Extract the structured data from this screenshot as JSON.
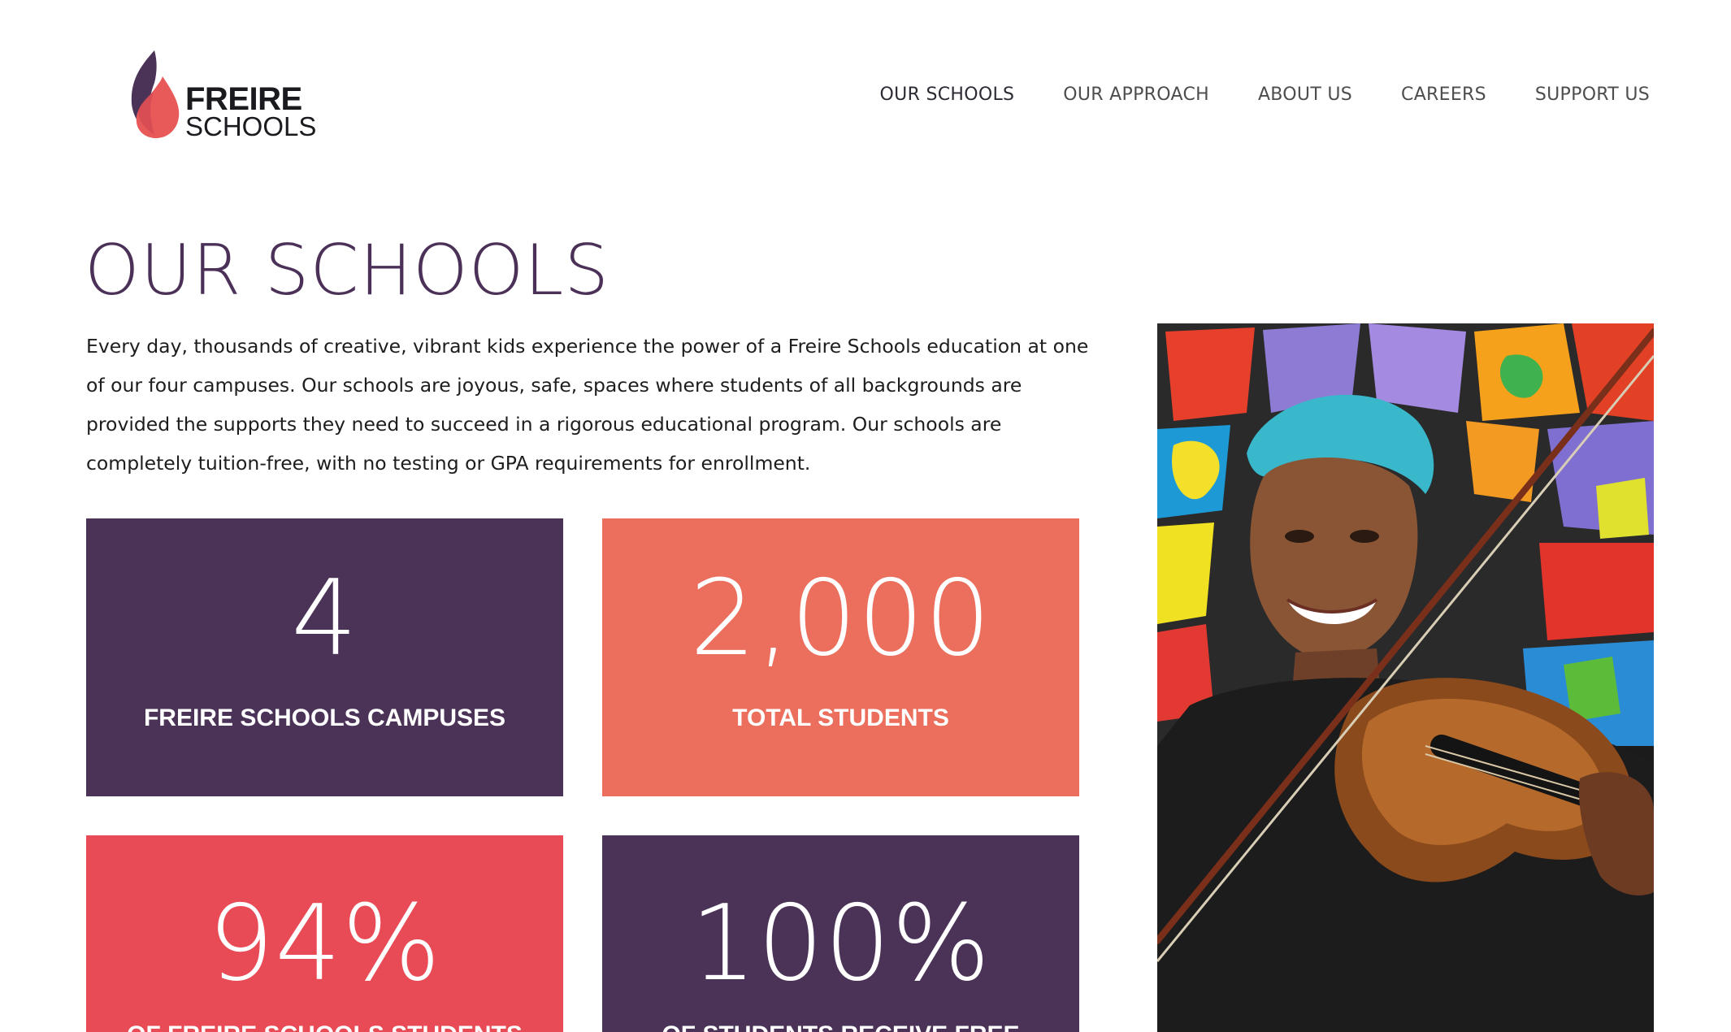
{
  "brand": {
    "name_line1": "FREIRE",
    "name_line2": "SCHOOLS",
    "colors": {
      "purple": "#4b3358",
      "coral": "#eb6f5c",
      "red": "#e84b55",
      "flame_light": "#e85a5a",
      "flame_dark": "#4b3358"
    }
  },
  "nav": {
    "items": [
      {
        "label": "OUR SCHOOLS"
      },
      {
        "label": "OUR APPROACH"
      },
      {
        "label": "ABOUT US"
      },
      {
        "label": "CAREERS"
      },
      {
        "label": "SUPPORT US"
      }
    ]
  },
  "main": {
    "title": "OUR SCHOOLS",
    "intro": "Every day, thousands of creative, vibrant kids experience the power of a Freire Schools education at one of our four campuses. Our schools are joyous, safe, spaces where students of all backgrounds are provided the supports they need to succeed in a rigorous educational program. Our schools are completely tuition-free, with no testing or GPA requirements for enrollment.",
    "stats": [
      {
        "value": "4",
        "label": "FREIRE SCHOOLS CAMPUSES",
        "color": "#4b3358"
      },
      {
        "value": "2,000",
        "label": "TOTAL STUDENTS",
        "color": "#eb6f5c"
      },
      {
        "value": "94%",
        "label": "OF FREIRE SCHOOLS STUDENTS ARE",
        "color": "#e84b55"
      },
      {
        "value": "100%",
        "label": "OF STUDENTS RECEIVE FREE",
        "color": "#4b3358"
      }
    ]
  },
  "photo": {
    "icon": "student-violin-photo"
  }
}
